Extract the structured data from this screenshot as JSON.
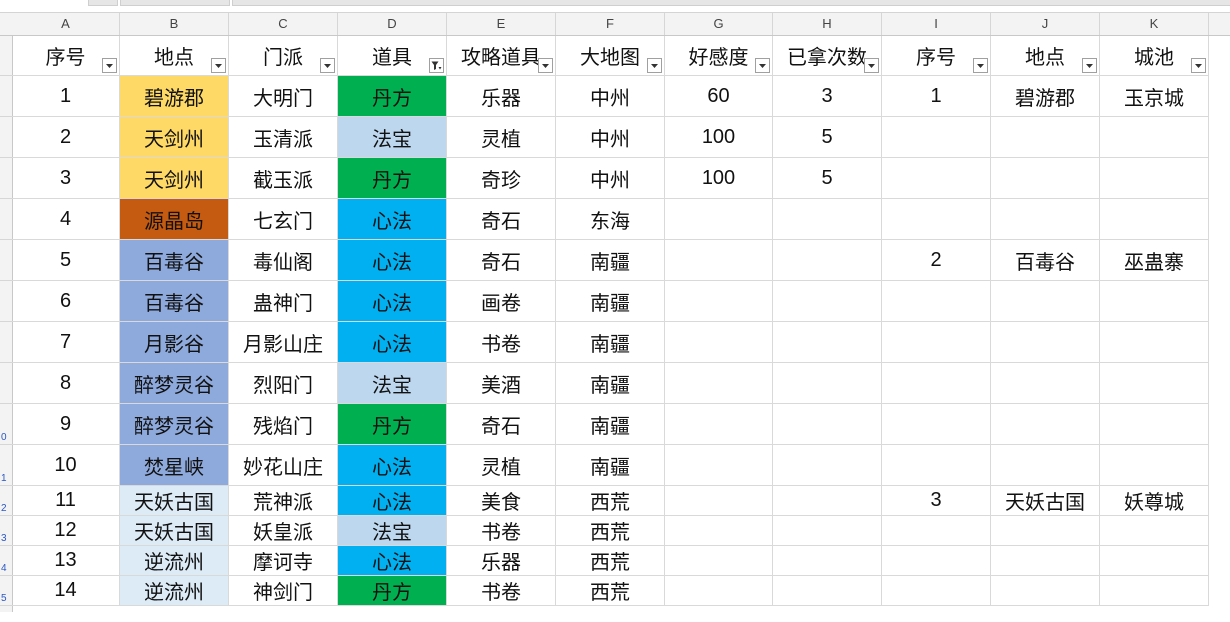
{
  "columns": [
    "A",
    "B",
    "C",
    "D",
    "E",
    "F",
    "G",
    "H",
    "I",
    "J",
    "K"
  ],
  "rownums": [
    "",
    "",
    "",
    "",
    "",
    "",
    "",
    "",
    "",
    "0",
    "1",
    "2",
    "3",
    "4",
    "5"
  ],
  "header": [
    "序号",
    "地点",
    "门派",
    "道具",
    "攻略道具",
    "大地图",
    "好感度",
    "已拿次数",
    "序号",
    "地点",
    "城池"
  ],
  "filter_icons": [
    "chevron-down-icon",
    "chevron-down-icon",
    "chevron-down-icon",
    "filter-active-icon",
    "chevron-down-icon",
    "chevron-down-icon",
    "chevron-down-icon",
    "chevron-down-icon",
    "chevron-down-icon",
    "chevron-down-icon",
    "chevron-down-icon"
  ],
  "rows": [
    [
      "1",
      "碧游郡",
      "大明门",
      "丹方",
      "乐器",
      "中州",
      "60",
      "3",
      "1",
      "碧游郡",
      "玉京城"
    ],
    [
      "2",
      "天剑州",
      "玉清派",
      "法宝",
      "灵植",
      "中州",
      "100",
      "5",
      "",
      "",
      ""
    ],
    [
      "3",
      "天剑州",
      "截玉派",
      "丹方",
      "奇珍",
      "中州",
      "100",
      "5",
      "",
      "",
      ""
    ],
    [
      "4",
      "源晶岛",
      "七玄门",
      "心法",
      "奇石",
      "东海",
      "",
      "",
      "",
      "",
      ""
    ],
    [
      "5",
      "百毒谷",
      "毒仙阁",
      "心法",
      "奇石",
      "南疆",
      "",
      "",
      "2",
      "百毒谷",
      "巫蛊寨"
    ],
    [
      "6",
      "百毒谷",
      "蛊神门",
      "心法",
      "画卷",
      "南疆",
      "",
      "",
      "",
      "",
      ""
    ],
    [
      "7",
      "月影谷",
      "月影山庄",
      "心法",
      "书卷",
      "南疆",
      "",
      "",
      "",
      "",
      ""
    ],
    [
      "8",
      "醉梦灵谷",
      "烈阳门",
      "法宝",
      "美酒",
      "南疆",
      "",
      "",
      "",
      "",
      ""
    ],
    [
      "9",
      "醉梦灵谷",
      "残焰门",
      "丹方",
      "奇石",
      "南疆",
      "",
      "",
      "",
      "",
      ""
    ],
    [
      "10",
      "焚星峡",
      "妙花山庄",
      "心法",
      "灵植",
      "南疆",
      "",
      "",
      "",
      "",
      ""
    ],
    [
      "11",
      "天妖古国",
      "荒神派",
      "心法",
      "美食",
      "西荒",
      "",
      "",
      "3",
      "天妖古国",
      "妖尊城"
    ],
    [
      "12",
      "天妖古国",
      "妖皇派",
      "法宝",
      "书卷",
      "西荒",
      "",
      "",
      "",
      "",
      ""
    ],
    [
      "13",
      "逆流州",
      "摩诃寺",
      "心法",
      "乐器",
      "西荒",
      "",
      "",
      "",
      "",
      ""
    ],
    [
      "14",
      "逆流州",
      "神剑门",
      "丹方",
      "书卷",
      "西荒",
      "",
      "",
      "",
      "",
      ""
    ]
  ],
  "colors": {
    "location": {
      "碧游郡": "#ffd966",
      "天剑州": "#ffd966",
      "源晶岛": "#c55a11",
      "百毒谷": "#8ea9db",
      "月影谷": "#8ea9db",
      "醉梦灵谷": "#8ea9db",
      "焚星峡": "#8ea9db",
      "天妖古国": "#ddebf7",
      "逆流州": "#ddebf7"
    },
    "item": {
      "丹方": "#00b050",
      "法宝": "#bdd7ee",
      "心法": "#00b0f0"
    }
  }
}
